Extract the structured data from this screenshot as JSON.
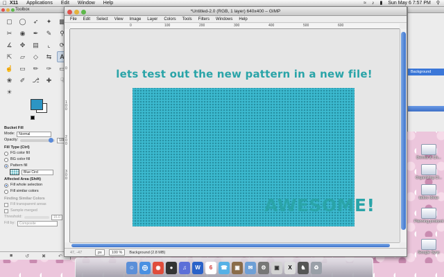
{
  "menubar": {
    "apple": "",
    "items": [
      "X11",
      "Applications",
      "Edit",
      "Window",
      "Help"
    ],
    "clock": "Sun May 6  7:57 PM"
  },
  "toolbox": {
    "title": "Toolbox",
    "tool_name": "Bucket Fill",
    "mode_label": "Mode:",
    "mode_value": "Normal",
    "opacity_label": "Opacity:",
    "opacity_value": "100.0",
    "fill_type_label": "Fill Type  (Ctrl)",
    "fill_options": [
      "FG color fill",
      "BG color fill",
      "Pattern fill"
    ],
    "selected_fill": 2,
    "pattern_name": "Blue Circl",
    "affected_label": "Affected Area  (Shift)",
    "affected_options": [
      "Fill whole selection",
      "Fill similar colors"
    ],
    "selected_affected": 0,
    "finding_label": "Finding Similar Colors",
    "fill_transparent_label": "Fill transparent areas",
    "sample_merged_label": "Sample merged",
    "threshold_label": "Threshold:",
    "threshold_value": "15.0",
    "fill_by_label": "Fill by:",
    "fill_by_value": "Composite"
  },
  "image_window": {
    "title": "*Untitled-2.0 (RGB, 1 layer) 640x400 – GIMP",
    "menu": [
      "File",
      "Edit",
      "Select",
      "View",
      "Image",
      "Layer",
      "Colors",
      "Tools",
      "Filters",
      "Windows",
      "Help"
    ],
    "ruler_top": [
      "0",
      "100",
      "200",
      "300",
      "400",
      "500",
      "600"
    ],
    "ruler_left": [
      "0",
      "1 0 0",
      "2 0 0",
      "3 0 0"
    ],
    "headline": "lets test out the new pattern in a new file!",
    "awesome": "AWESOME!",
    "status": {
      "coords": "47, -47",
      "unit": "px",
      "zoom": "100 %",
      "layer_info": "Background (2.8 MB)"
    }
  },
  "layers_panel": {
    "layer_name": "Background"
  },
  "desktop_icons": [
    "Dennis & Ch...",
    "Organizing Cl...",
    "tattoo ideas",
    "Planning protocol",
    "Google Sync"
  ],
  "dock": {
    "apps": [
      "finder",
      "safari",
      "chrome",
      "dashboard",
      "itunes",
      "word",
      "ical",
      "ichat",
      "photo",
      "mail",
      "system",
      "preview",
      "x11",
      "chess",
      "trash"
    ]
  },
  "colors": {
    "accent_text": "#2aa4a8",
    "pattern_fill": "#2e9eb0",
    "foreground": "#2c95c4"
  }
}
